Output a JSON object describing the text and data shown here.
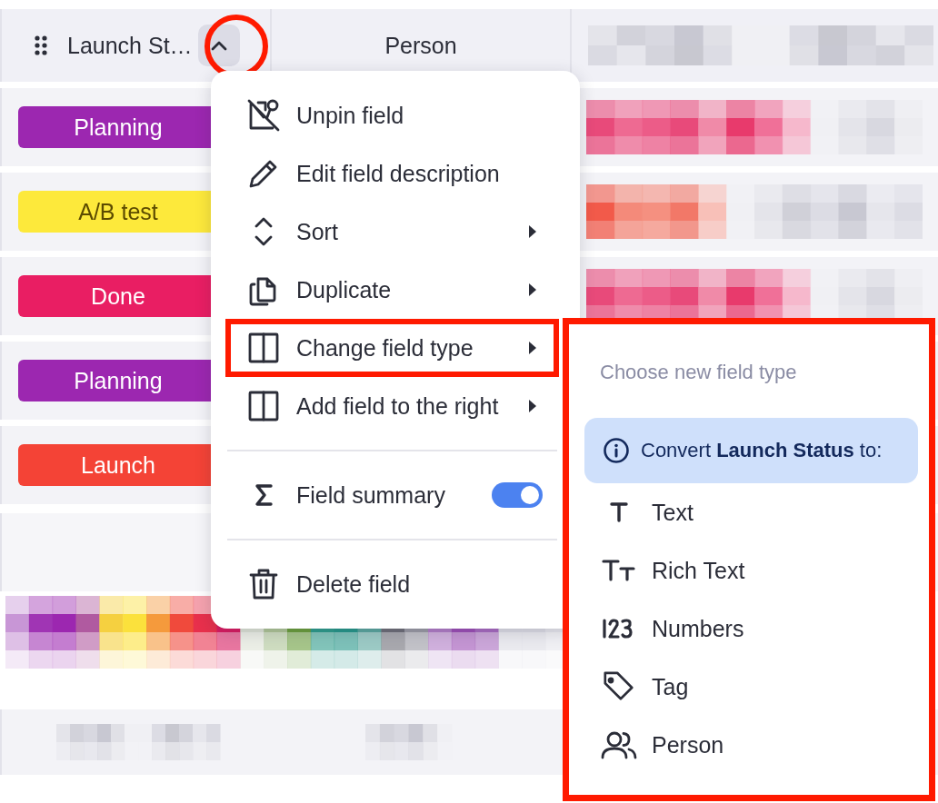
{
  "header": {
    "columns": [
      {
        "label": "Launch St…",
        "menu_open": true,
        "highlighted": true
      },
      {
        "label": "Person"
      }
    ]
  },
  "rows": [
    {
      "status": "Planning",
      "color": "#9c27b0"
    },
    {
      "status": "A/B test",
      "color": "#fde93b"
    },
    {
      "status": "Done",
      "color": "#e91e63"
    },
    {
      "status": "Planning",
      "color": "#9c27b0"
    },
    {
      "status": "Launch",
      "color": "#f44336"
    }
  ],
  "menu": {
    "sections": [
      [
        {
          "kind": "action",
          "label": "Unpin field",
          "highlighted": false
        },
        {
          "kind": "action",
          "label": "Edit field description",
          "highlighted": false
        },
        {
          "kind": "submenu",
          "label": "Sort",
          "highlighted": false
        },
        {
          "kind": "submenu",
          "label": "Duplicate",
          "highlighted": false
        },
        {
          "kind": "submenu",
          "label": "Change field type",
          "highlighted": true
        },
        {
          "kind": "submenu",
          "label": "Add field to the right",
          "highlighted": false
        }
      ],
      [
        {
          "kind": "toggle",
          "label": "Field summary",
          "on": true,
          "highlighted": false
        }
      ],
      [
        {
          "kind": "action",
          "label": "Delete field",
          "highlighted": false
        }
      ]
    ]
  },
  "submenu": {
    "highlighted": true,
    "title": "Choose new field type",
    "notice": "Convert **Launch Status** to:",
    "types": [
      {
        "label": "Text"
      },
      {
        "label": "Rich Text"
      },
      {
        "label": "Numbers"
      },
      {
        "label": "Tag"
      },
      {
        "label": "Person"
      }
    ]
  }
}
